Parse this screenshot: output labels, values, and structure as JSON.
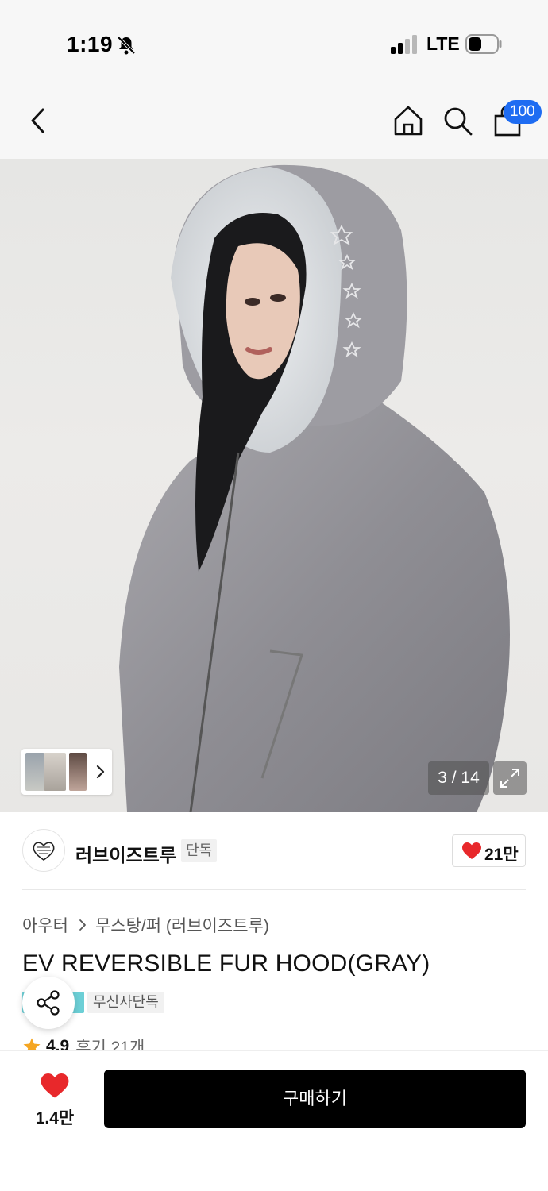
{
  "status_bar": {
    "time": "1:19",
    "network": "LTE"
  },
  "nav": {
    "cart_count": "100"
  },
  "gallery": {
    "counter": "3 / 14"
  },
  "brand": {
    "name": "러브이즈트루",
    "tag": "단독",
    "likes": "21만"
  },
  "product": {
    "breadcrumb": [
      "아우터",
      "무스탕/퍼 (러브이즈트루)"
    ],
    "title": "EV REVERSIBLE FUR HOOD(GRAY)",
    "badges": [
      "무신사단독"
    ],
    "rating": "4.9",
    "reviews": "후기 21개"
  },
  "bottom_bar": {
    "wish_count": "1.4만",
    "buy_label": "구매하기"
  },
  "colors": {
    "accent_blue": "#1e6cf2",
    "heart_red": "#e8282b",
    "buy_button": "#000000",
    "star": "#f5a623"
  }
}
